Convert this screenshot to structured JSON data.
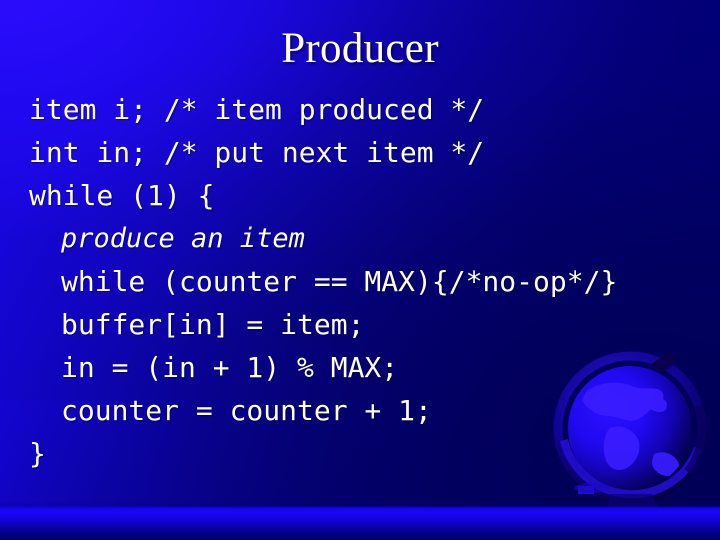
{
  "slide": {
    "title": "Producer",
    "background": {
      "top_left_color": "#1b06f6",
      "bottom_right_color": "#00006e",
      "band_color": "#1a06f8"
    },
    "title_color": "#fffff0",
    "code_color": "#fdfdf2"
  },
  "code": {
    "lines": [
      {
        "text": "item i; /* item produced */",
        "indent": 0,
        "italic": false
      },
      {
        "text": "int in; /* put next item */",
        "indent": 0,
        "italic": false
      },
      {
        "text": "while (1) {",
        "indent": 0,
        "italic": false
      },
      {
        "text": "produce an item",
        "indent": 1,
        "italic": true
      },
      {
        "text": "while (counter == MAX){/*no-op*/}",
        "indent": 1,
        "italic": false
      },
      {
        "text": "buffer[in] = item;",
        "indent": 1,
        "italic": false
      },
      {
        "text": "in = (in + 1) % MAX;",
        "indent": 1,
        "italic": false
      },
      {
        "text": "counter = counter + 1;",
        "indent": 1,
        "italic": false
      },
      {
        "text": "}",
        "indent": 0,
        "italic": false
      }
    ]
  },
  "decoration": {
    "globe_label": "globe-graphic"
  }
}
